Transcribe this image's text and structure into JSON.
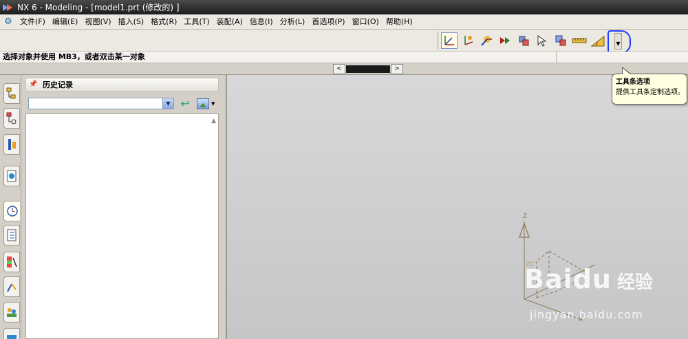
{
  "window": {
    "title": "NX 6 - Modeling - [model1.prt  (修改的) ]"
  },
  "menu": [
    "文件(F)",
    "编辑(E)",
    "视图(V)",
    "插入(S)",
    "格式(R)",
    "工具(T)",
    "装配(A)",
    "信息(I)",
    "分析(L)",
    "首选项(P)",
    "窗口(O)",
    "帮助(H)"
  ],
  "toolbar": {
    "icons": [
      "wcs-display-icon",
      "wcs-origin-icon",
      "wcs-dynamics-icon",
      "wcs-orient-icon",
      "wcs-rotate-icon",
      "select-icon",
      "set-wcs-icon",
      "measure-distance-icon",
      "measure-angle-icon"
    ]
  },
  "cue": {
    "text": "选择对象并使用 MB3，或者双击某一对象"
  },
  "panel": {
    "title": "历史记录"
  },
  "tooltip": {
    "title": "工具条选项",
    "body": "提供工具条定制选项。"
  },
  "axes": {
    "z_label": "Z",
    "zc_label": "ZC",
    "x_label": "X"
  },
  "watermark": {
    "logo": "Baidu",
    "logo_cn": "经验",
    "url": "jingyan.baidu.com"
  },
  "colors": {
    "title_bar": "#2c2c2c",
    "tooltip_bg": "#ffffe1",
    "highlight_ring": "#1f3cff",
    "axis": "#8a7a50"
  }
}
